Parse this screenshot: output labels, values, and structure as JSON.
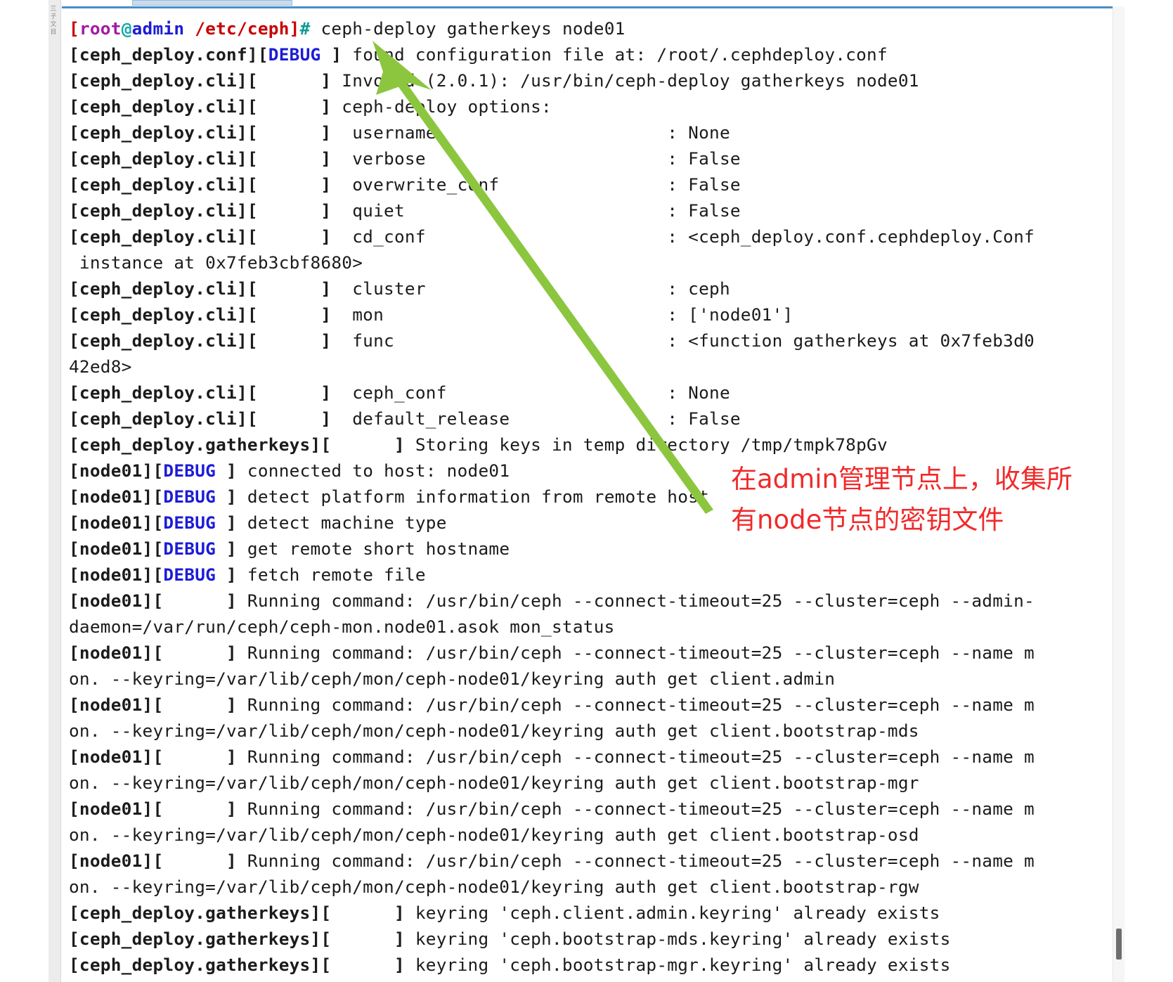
{
  "left_marks": "三\n子\n文\n目",
  "prompt": {
    "open": "[",
    "user": "root",
    "at": "@",
    "host": "admin",
    "path": "/etc/ceph",
    "close": "]",
    "hash": "#",
    "command": " ceph-deploy gatherkeys node01"
  },
  "log_lines": [
    {
      "prefix": "[ceph_deploy.conf][",
      "tag": "DEBUG",
      "suffix": " ] ",
      "message": "found configuration file at: /root/.cephdeploy.conf"
    },
    {
      "prefix": "[ceph_deploy.cli][      ] ",
      "tag": "",
      "suffix": "",
      "message": "Invoked (2.0.1): /usr/bin/ceph-deploy gatherkeys node01"
    },
    {
      "prefix": "[ceph_deploy.cli][      ] ",
      "tag": "",
      "suffix": "",
      "message": "ceph-deploy options:"
    },
    {
      "prefix": "[ceph_deploy.cli][      ]  ",
      "tag": "",
      "suffix": "",
      "message": "username                      : None"
    },
    {
      "prefix": "[ceph_deploy.cli][      ]  ",
      "tag": "",
      "suffix": "",
      "message": "verbose                       : False"
    },
    {
      "prefix": "[ceph_deploy.cli][      ]  ",
      "tag": "",
      "suffix": "",
      "message": "overwrite_conf                : False"
    },
    {
      "prefix": "[ceph_deploy.cli][      ]  ",
      "tag": "",
      "suffix": "",
      "message": "quiet                         : False"
    },
    {
      "prefix": "[ceph_deploy.cli][      ]  ",
      "tag": "",
      "suffix": "",
      "message": "cd_conf                       : <ceph_deploy.conf.cephdeploy.Conf"
    },
    {
      "prefix": "",
      "tag": "",
      "suffix": "",
      "message": " instance at 0x7feb3cbf8680>",
      "cont": true
    },
    {
      "prefix": "[ceph_deploy.cli][      ]  ",
      "tag": "",
      "suffix": "",
      "message": "cluster                       : ceph"
    },
    {
      "prefix": "[ceph_deploy.cli][      ]  ",
      "tag": "",
      "suffix": "",
      "message": "mon                           : ['node01']"
    },
    {
      "prefix": "[ceph_deploy.cli][      ]  ",
      "tag": "",
      "suffix": "",
      "message": "func                          : <function gatherkeys at 0x7feb3d0"
    },
    {
      "prefix": "",
      "tag": "",
      "suffix": "",
      "message": "42ed8>",
      "cont": true
    },
    {
      "prefix": "[ceph_deploy.cli][      ]  ",
      "tag": "",
      "suffix": "",
      "message": "ceph_conf                     : None"
    },
    {
      "prefix": "[ceph_deploy.cli][      ]  ",
      "tag": "",
      "suffix": "",
      "message": "default_release               : False"
    },
    {
      "prefix": "[ceph_deploy.gatherkeys][      ] ",
      "tag": "",
      "suffix": "",
      "message": "Storing keys in temp directory /tmp/tmpk78pGv"
    },
    {
      "prefix": "[node01][",
      "tag": "DEBUG",
      "suffix": " ] ",
      "message": "connected to host: node01"
    },
    {
      "prefix": "[node01][",
      "tag": "DEBUG",
      "suffix": " ] ",
      "message": "detect platform information from remote host"
    },
    {
      "prefix": "[node01][",
      "tag": "DEBUG",
      "suffix": " ] ",
      "message": "detect machine type"
    },
    {
      "prefix": "[node01][",
      "tag": "DEBUG",
      "suffix": " ] ",
      "message": "get remote short hostname"
    },
    {
      "prefix": "[node01][",
      "tag": "DEBUG",
      "suffix": " ] ",
      "message": "fetch remote file"
    },
    {
      "prefix": "[node01][      ] ",
      "tag": "",
      "suffix": "",
      "message": "Running command: /usr/bin/ceph --connect-timeout=25 --cluster=ceph --admin-"
    },
    {
      "prefix": "",
      "tag": "",
      "suffix": "",
      "message": "daemon=/var/run/ceph/ceph-mon.node01.asok mon_status",
      "cont": true
    },
    {
      "prefix": "[node01][      ] ",
      "tag": "",
      "suffix": "",
      "message": "Running command: /usr/bin/ceph --connect-timeout=25 --cluster=ceph --name m"
    },
    {
      "prefix": "",
      "tag": "",
      "suffix": "",
      "message": "on. --keyring=/var/lib/ceph/mon/ceph-node01/keyring auth get client.admin",
      "cont": true
    },
    {
      "prefix": "[node01][      ] ",
      "tag": "",
      "suffix": "",
      "message": "Running command: /usr/bin/ceph --connect-timeout=25 --cluster=ceph --name m"
    },
    {
      "prefix": "",
      "tag": "",
      "suffix": "",
      "message": "on. --keyring=/var/lib/ceph/mon/ceph-node01/keyring auth get client.bootstrap-mds",
      "cont": true
    },
    {
      "prefix": "[node01][      ] ",
      "tag": "",
      "suffix": "",
      "message": "Running command: /usr/bin/ceph --connect-timeout=25 --cluster=ceph --name m"
    },
    {
      "prefix": "",
      "tag": "",
      "suffix": "",
      "message": "on. --keyring=/var/lib/ceph/mon/ceph-node01/keyring auth get client.bootstrap-mgr",
      "cont": true
    },
    {
      "prefix": "[node01][      ] ",
      "tag": "",
      "suffix": "",
      "message": "Running command: /usr/bin/ceph --connect-timeout=25 --cluster=ceph --name m"
    },
    {
      "prefix": "",
      "tag": "",
      "suffix": "",
      "message": "on. --keyring=/var/lib/ceph/mon/ceph-node01/keyring auth get client.bootstrap-osd",
      "cont": true
    },
    {
      "prefix": "[node01][      ] ",
      "tag": "",
      "suffix": "",
      "message": "Running command: /usr/bin/ceph --connect-timeout=25 --cluster=ceph --name m"
    },
    {
      "prefix": "",
      "tag": "",
      "suffix": "",
      "message": "on. --keyring=/var/lib/ceph/mon/ceph-node01/keyring auth get client.bootstrap-rgw",
      "cont": true
    },
    {
      "prefix": "[ceph_deploy.gatherkeys][      ] ",
      "tag": "",
      "suffix": "",
      "message": "keyring 'ceph.client.admin.keyring' already exists"
    },
    {
      "prefix": "[ceph_deploy.gatherkeys][      ] ",
      "tag": "",
      "suffix": "",
      "message": "keyring 'ceph.bootstrap-mds.keyring' already exists"
    },
    {
      "prefix": "[ceph_deploy.gatherkeys][      ] ",
      "tag": "",
      "suffix": "",
      "message": "keyring 'ceph.bootstrap-mgr.keyring' already exists"
    }
  ],
  "annotation": {
    "line1": "在admin管理节点上，收集所",
    "line2": "有node节点的密钥文件",
    "color": "#f02a2a"
  },
  "arrow": {
    "color": "#8cc63f",
    "icon": "arrow-icon"
  },
  "colors": {
    "prompt_user": "#a31aa3",
    "prompt_bracket": "#c80000",
    "prompt_host": "#1c1cd6",
    "debug_tag": "#1c1cd6",
    "hash": "#12a8a8"
  }
}
